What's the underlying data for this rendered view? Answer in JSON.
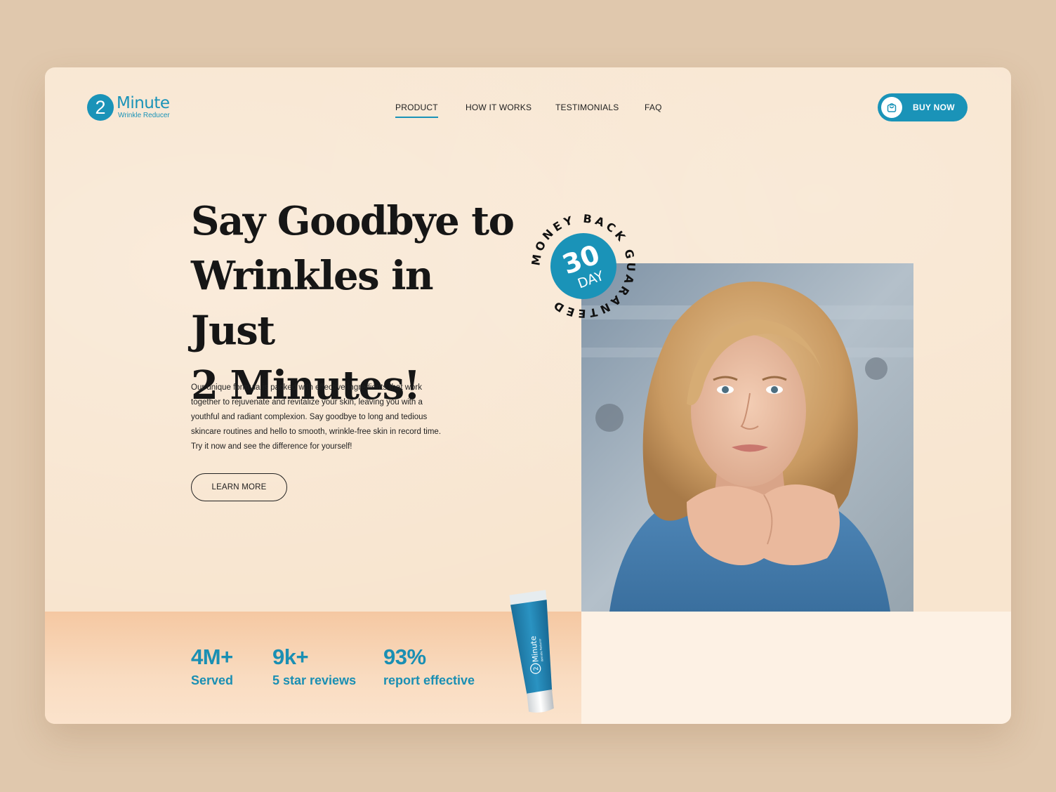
{
  "brand": {
    "logo_number": "2",
    "logo_word": "Minute",
    "logo_sub": "Wrinkle Reducer",
    "accent_color": "#1a93b8"
  },
  "nav": {
    "items": [
      {
        "label": "PRODUCT",
        "active": true
      },
      {
        "label": "HOW IT WORKS",
        "active": false
      },
      {
        "label": "TESTIMONIALS",
        "active": false
      },
      {
        "label": "FAQ",
        "active": false
      }
    ]
  },
  "header": {
    "buy_label": "BUY NOW",
    "buy_icon": "shopping-bag-icon"
  },
  "hero": {
    "headline_lines": [
      "Say Goodbye to",
      "Wrinkles in Just",
      "2 Minutes!"
    ],
    "description": "Our unique formula is packed with effective ingredients that work together to rejuvenate and revitalize your skin, leaving you with a youthful and radiant complexion. Say goodbye to long and tedious skincare routines and hello to smooth, wrinkle-free skin in record time. Try it now and see the difference for yourself!",
    "cta_label": "LEARN MORE"
  },
  "badge": {
    "number": "30",
    "unit": "DAY",
    "ring_text": "MONEY BACK GUARANTEED"
  },
  "stats": [
    {
      "value": "4M+",
      "label": "Served"
    },
    {
      "value": "9k+",
      "label": "5 star reviews"
    },
    {
      "value": "93%",
      "label": "report effective"
    }
  ],
  "product_tube": {
    "number": "2",
    "word": "Minute",
    "sub": "Wrinkle Reducer"
  }
}
